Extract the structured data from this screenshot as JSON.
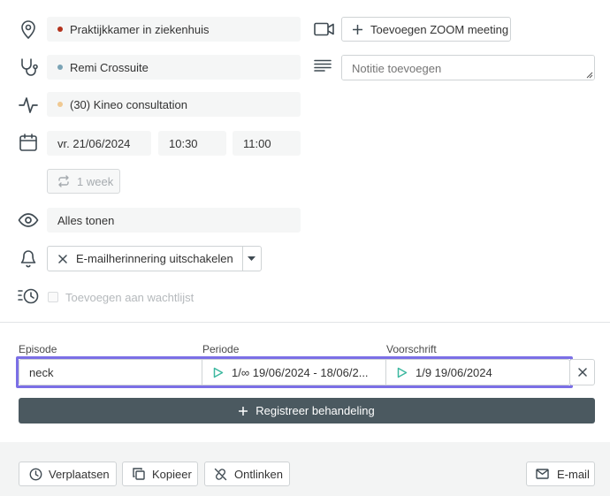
{
  "location": {
    "value": "Praktijkkamer in ziekenhuis",
    "dot_color": "#b3321c"
  },
  "practitioner": {
    "value": "Remi Crossuite",
    "dot_color": "#7aa3b5"
  },
  "service": {
    "value": "(30) Kineo consultation",
    "dot_color": "#f0c992"
  },
  "schedule": {
    "date": "vr. 21/06/2024",
    "start": "10:30",
    "end": "11:00"
  },
  "repeat_label": "1 week",
  "visibility": {
    "value": "Alles tonen"
  },
  "reminder": {
    "label": "E-mailherinnering uitschakelen"
  },
  "waitlist_label": "Toevoegen aan wachtlijst",
  "zoom_button": "Toevoegen ZOOM meeting",
  "note": {
    "placeholder": "Notitie toevoegen"
  },
  "episode": {
    "headers": {
      "episode": "Episode",
      "period": "Periode",
      "prescription": "Voorschrift"
    },
    "episode_value": "neck",
    "period_value": "1/∞ 19/06/2024 - 18/06/2...",
    "prescription_value": "1/9 19/06/2024"
  },
  "register_button": "Registreer behandeling",
  "footer": {
    "move": "Verplaatsen",
    "copy": "Kopieer",
    "unlink": "Ontlinken",
    "email": "E-mail"
  },
  "colors": {
    "accent": "#7b6fe6",
    "teal": "#3db8a0",
    "dark": "#4b5960"
  }
}
